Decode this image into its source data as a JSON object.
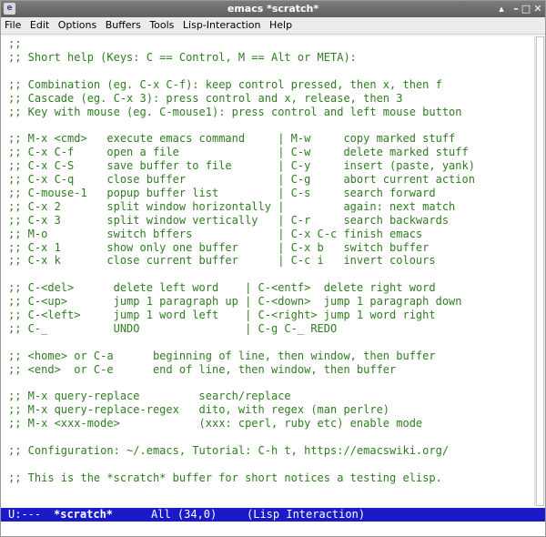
{
  "window": {
    "title": "emacs *scratch*",
    "app_icon": "e",
    "buttons": {
      "sticky": "▴",
      "minimize": "–",
      "maximize": "□",
      "close": "✕"
    }
  },
  "menubar": {
    "items": [
      "File",
      "Edit",
      "Options",
      "Buffers",
      "Tools",
      "Lisp-Interaction",
      "Help"
    ]
  },
  "buffer": {
    "lines": [
      ";;",
      ";; Short help (Keys: C == Control, M == Alt or META):",
      "",
      ";; Combination (eg. C-x C-f): keep control pressed, then x, then f",
      ";; Cascade (eg. C-x 3): press control and x, release, then 3",
      ";; Key with mouse (eg. C-mouse1): press control and left mouse button",
      "",
      ";; M-x <cmd>   execute emacs command     | M-w     copy marked stuff",
      ";; C-x C-f     open a file               | C-w     delete marked stuff",
      ";; C-x C-S     save buffer to file       | C-y     insert (paste, yank)",
      ";; C-x C-q     close buffer              | C-g     abort current action",
      ";; C-mouse-1   popup buffer list         | C-s     search forward",
      ";; C-x 2       split window horizontally |         again: next match",
      ";; C-x 3       split window vertically   | C-r     search backwards",
      ";; M-o         switch bffers             | C-x C-c finish emacs",
      ";; C-x 1       show only one buffer      | C-x b   switch buffer",
      ";; C-x k       close current buffer      | C-c i   invert colours",
      "",
      ";; C-<del>      delete left word    | C-<entf>  delete right word",
      ";; C-<up>       jump 1 paragraph up | C-<down>  jump 1 paragraph down",
      ";; C-<left>     jump 1 word left    | C-<right> jump 1 word right",
      ";; C-_          UNDO                | C-g C-_ REDO",
      "",
      ";; <home> or C-a      beginning of line, then window, then buffer",
      ";; <end>  or C-e      end of line, then window, then buffer",
      "",
      ";; M-x query-replace         search/replace",
      ";; M-x query-replace-regex   dito, with regex (man perlre)",
      ";; M-x <xxx-mode>            (xxx: cperl, ruby etc) enable mode",
      "",
      ";; Configuration: ~/.emacs, Tutorial: C-h t, https://emacswiki.org/",
      "",
      ";; This is the *scratch* buffer for short notices a testing elisp.",
      ""
    ]
  },
  "modeline": {
    "status": "U:---",
    "buffer_name": "*scratch*",
    "position": "All (34,0)",
    "mode": "(Lisp Interaction)"
  },
  "colors": {
    "comment_text": "#2e7d20",
    "modeline_bg": "#1a1ac8",
    "titlebar_bg": "#6e6e6e"
  }
}
